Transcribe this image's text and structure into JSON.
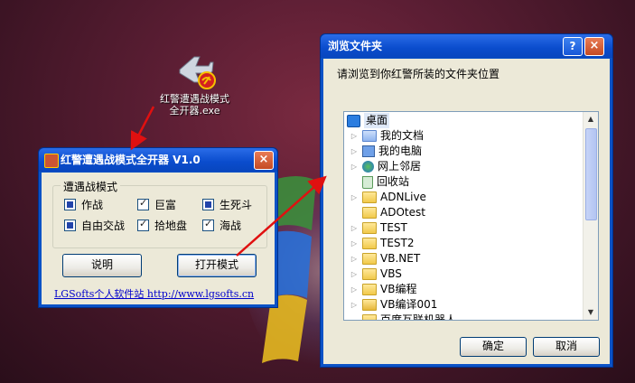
{
  "desktop_icon": {
    "line1": "红警遭遇战模式",
    "line2": "全开器.exe"
  },
  "app_window": {
    "title": "红警遭遇战模式全开器 V1.0",
    "close": "×",
    "group_title": "遭遇战模式",
    "options": [
      {
        "label": "作战",
        "checked": true
      },
      {
        "label": "巨富",
        "checked": true
      },
      {
        "label": "生死斗",
        "checked": true
      },
      {
        "label": "自由交战",
        "checked": true
      },
      {
        "label": "拾地盘",
        "checked": true
      },
      {
        "label": "海战",
        "checked": true
      }
    ],
    "help_button": "说明",
    "open_button": "打开模式",
    "footer_link": "LGSofts个人软件站 http://www.lgsofts.cn"
  },
  "browse_dialog": {
    "title": "浏览文件夹",
    "help": "?",
    "close": "×",
    "prompt": "请浏览到你红警所装的文件夹位置",
    "root": "桌面",
    "items": [
      "我的文档",
      "我的电脑",
      "网上邻居",
      "回收站",
      "ADNLive",
      "ADOtest",
      "TEST",
      "TEST2",
      "VB.NET",
      "VBS",
      "VB编程",
      "VB编译001",
      "百度互联机器人"
    ],
    "ok_button": "确定",
    "cancel_button": "取消"
  },
  "colors": {
    "titlebar": "#0a4ccc",
    "client": "#ece9d8",
    "arrow": "#e01010"
  }
}
